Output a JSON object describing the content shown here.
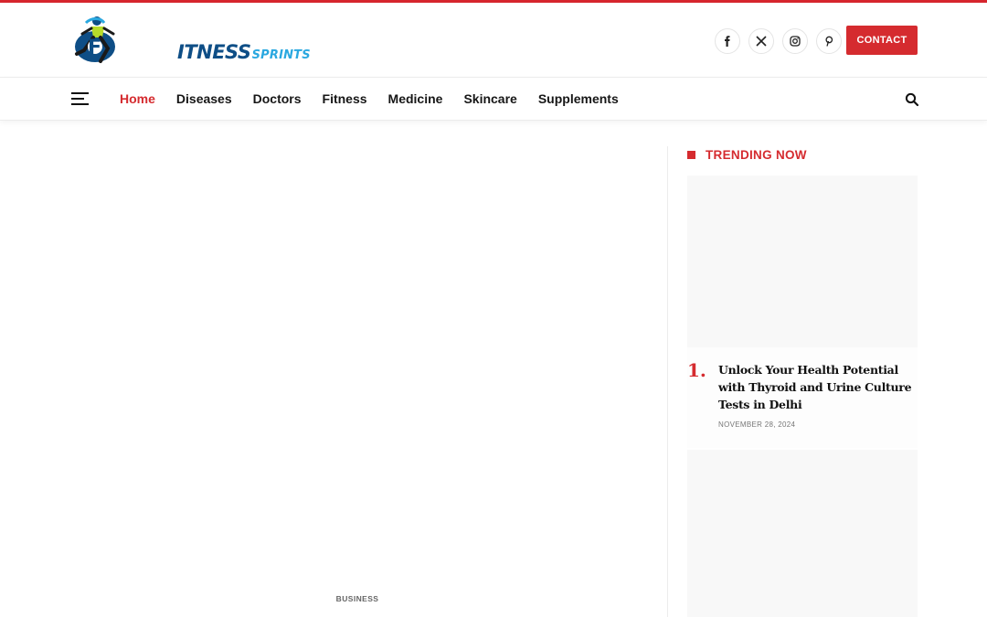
{
  "brand": {
    "logo_main": "ITNESS",
    "logo_sub": "SPRINTS",
    "accent": "#d52b2f",
    "logo_blue": "#0e4e86",
    "logo_light_blue": "#2aa8e0"
  },
  "header": {
    "socials": [
      {
        "name": "facebook-icon"
      },
      {
        "name": "x-icon"
      },
      {
        "name": "instagram-icon"
      },
      {
        "name": "pinterest-icon"
      }
    ],
    "contact_label": "CONTACT"
  },
  "nav": {
    "items": [
      {
        "label": "Home",
        "active": true
      },
      {
        "label": "Diseases"
      },
      {
        "label": "Doctors"
      },
      {
        "label": "Fitness"
      },
      {
        "label": "Medicine"
      },
      {
        "label": "Skincare"
      },
      {
        "label": "Supplements"
      }
    ]
  },
  "main": {
    "category_label": "BUSINESS"
  },
  "sidebar": {
    "heading": "TRENDING NOW",
    "items": [
      {
        "number": "1.",
        "title": "Unlock Your Health Potential with Thyroid and Urine Culture Tests in Delhi",
        "date": "NOVEMBER 28, 2024"
      }
    ]
  }
}
